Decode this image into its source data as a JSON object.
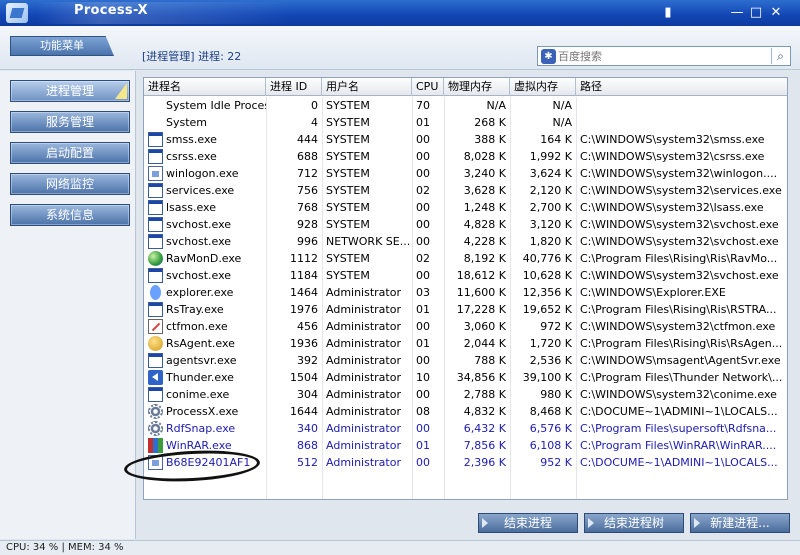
{
  "window": {
    "title": "Process-X"
  },
  "toolbar": {
    "func_menu": "功能菜单",
    "breadcrumb": "[进程管理] 进程: 22"
  },
  "search": {
    "placeholder": "百度搜索"
  },
  "sidebar": {
    "items": [
      {
        "label": "进程管理",
        "active": true
      },
      {
        "label": "服务管理"
      },
      {
        "label": "启动配置"
      },
      {
        "label": "网络监控"
      },
      {
        "label": "系统信息"
      }
    ]
  },
  "table": {
    "columns": [
      "进程名",
      "进程 ID",
      "用户名",
      "CPU",
      "物理内存",
      "虚拟内存",
      "路径"
    ],
    "rows": [
      {
        "name": "System Idle Process",
        "pid": "0",
        "user": "SYSTEM",
        "cpu": "70",
        "mem": "N/A",
        "vmem": "N/A",
        "path": "",
        "icon": "blank"
      },
      {
        "name": "System",
        "pid": "4",
        "user": "SYSTEM",
        "cpu": "01",
        "mem": "268 K",
        "vmem": "N/A",
        "path": "",
        "icon": "blank"
      },
      {
        "name": "smss.exe",
        "pid": "444",
        "user": "SYSTEM",
        "cpu": "00",
        "mem": "388 K",
        "vmem": "164 K",
        "path": "C:\\WINDOWS\\system32\\smss.exe",
        "icon": "window"
      },
      {
        "name": "csrss.exe",
        "pid": "688",
        "user": "SYSTEM",
        "cpu": "00",
        "mem": "8,028 K",
        "vmem": "1,992 K",
        "path": "C:\\WINDOWS\\system32\\csrss.exe",
        "icon": "window"
      },
      {
        "name": "winlogon.exe",
        "pid": "712",
        "user": "SYSTEM",
        "cpu": "00",
        "mem": "3,240 K",
        "vmem": "3,624 K",
        "path": "C:\\WINDOWS\\system32\\winlogon....",
        "icon": "doc"
      },
      {
        "name": "services.exe",
        "pid": "756",
        "user": "SYSTEM",
        "cpu": "02",
        "mem": "3,628 K",
        "vmem": "2,120 K",
        "path": "C:\\WINDOWS\\system32\\services.exe",
        "icon": "window"
      },
      {
        "name": "lsass.exe",
        "pid": "768",
        "user": "SYSTEM",
        "cpu": "00",
        "mem": "1,248 K",
        "vmem": "2,700 K",
        "path": "C:\\WINDOWS\\system32\\lsass.exe",
        "icon": "window"
      },
      {
        "name": "svchost.exe",
        "pid": "928",
        "user": "SYSTEM",
        "cpu": "00",
        "mem": "4,828 K",
        "vmem": "3,120 K",
        "path": "C:\\WINDOWS\\system32\\svchost.exe",
        "icon": "window"
      },
      {
        "name": "svchost.exe",
        "pid": "996",
        "user": "NETWORK SE...",
        "cpu": "00",
        "mem": "4,228 K",
        "vmem": "1,820 K",
        "path": "C:\\WINDOWS\\system32\\svchost.exe",
        "icon": "window"
      },
      {
        "name": "RavMonD.exe",
        "pid": "1112",
        "user": "SYSTEM",
        "cpu": "02",
        "mem": "8,192 K",
        "vmem": "40,776 K",
        "path": "C:\\Program Files\\Rising\\Ris\\RavMo...",
        "icon": "globe"
      },
      {
        "name": "svchost.exe",
        "pid": "1184",
        "user": "SYSTEM",
        "cpu": "00",
        "mem": "18,612 K",
        "vmem": "10,628 K",
        "path": "C:\\WINDOWS\\system32\\svchost.exe",
        "icon": "window"
      },
      {
        "name": "explorer.exe",
        "pid": "1464",
        "user": "Administrator",
        "cpu": "03",
        "mem": "11,600 K",
        "vmem": "12,356 K",
        "path": "C:\\WINDOWS\\Explorer.EXE",
        "icon": "person"
      },
      {
        "name": "RsTray.exe",
        "pid": "1976",
        "user": "Administrator",
        "cpu": "01",
        "mem": "17,228 K",
        "vmem": "19,652 K",
        "path": "C:\\Program Files\\Rising\\Ris\\RSTRA...",
        "icon": "window"
      },
      {
        "name": "ctfmon.exe",
        "pid": "456",
        "user": "Administrator",
        "cpu": "00",
        "mem": "3,060 K",
        "vmem": "972 K",
        "path": "C:\\WINDOWS\\system32\\ctfmon.exe",
        "icon": "note"
      },
      {
        "name": "RsAgent.exe",
        "pid": "1936",
        "user": "Administrator",
        "cpu": "01",
        "mem": "2,044 K",
        "vmem": "1,720 K",
        "path": "C:\\Program Files\\Rising\\Ris\\RsAgen...",
        "icon": "face"
      },
      {
        "name": "agentsvr.exe",
        "pid": "392",
        "user": "Administrator",
        "cpu": "00",
        "mem": "788 K",
        "vmem": "2,536 K",
        "path": "C:\\WINDOWS\\msagent\\AgentSvr.exe",
        "icon": "window"
      },
      {
        "name": "Thunder.exe",
        "pid": "1504",
        "user": "Administrator",
        "cpu": "10",
        "mem": "34,856 K",
        "vmem": "39,100 K",
        "path": "C:\\Program Files\\Thunder Network\\...",
        "icon": "bird"
      },
      {
        "name": "conime.exe",
        "pid": "304",
        "user": "Administrator",
        "cpu": "00",
        "mem": "2,788 K",
        "vmem": "980 K",
        "path": "C:\\WINDOWS\\system32\\conime.exe",
        "icon": "window"
      },
      {
        "name": "ProcessX.exe",
        "pid": "1644",
        "user": "Administrator",
        "cpu": "08",
        "mem": "4,832 K",
        "vmem": "8,468 K",
        "path": "C:\\DOCUME~1\\ADMINI~1\\LOCALS...",
        "icon": "gear"
      },
      {
        "name": "RdfSnap.exe",
        "pid": "340",
        "user": "Administrator",
        "cpu": "00",
        "mem": "6,432 K",
        "vmem": "6,576 K",
        "path": "C:\\Program Files\\supersoft\\Rdfsna...",
        "icon": "gear",
        "highlight": "blue"
      },
      {
        "name": "WinRAR.exe",
        "pid": "868",
        "user": "Administrator",
        "cpu": "01",
        "mem": "7,856 K",
        "vmem": "6,108 K",
        "path": "C:\\Program Files\\WinRAR\\WinRAR....",
        "icon": "books",
        "highlight": "blue"
      },
      {
        "name": "B68E92401AF1",
        "pid": "512",
        "user": "Administrator",
        "cpu": "00",
        "mem": "2,396 K",
        "vmem": "952 K",
        "path": "C:\\DOCUME~1\\ADMINI~1\\LOCALS...",
        "icon": "doc",
        "highlight": "blue"
      }
    ]
  },
  "actions": {
    "end_process": "结束进程",
    "end_tree": "结束进程树",
    "new_process": "新建进程..."
  },
  "status": {
    "text": "CPU: 34 %  |  MEM: 34 %"
  }
}
